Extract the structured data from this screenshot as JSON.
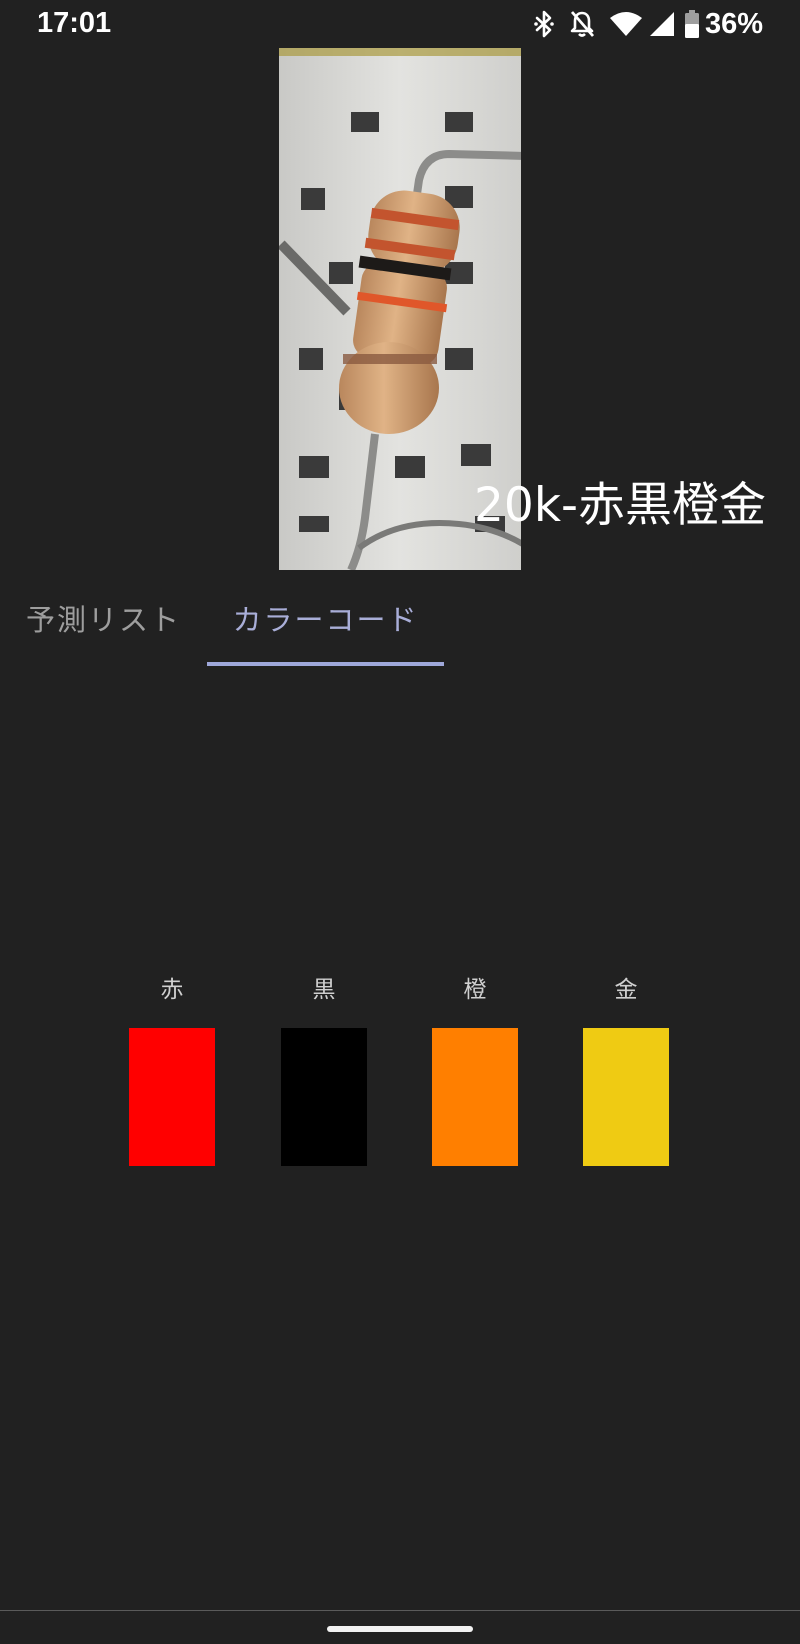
{
  "status_bar": {
    "time": "17:01",
    "battery_percent": "36%",
    "icons": [
      "bluetooth-icon",
      "notifications-off-icon",
      "wifi-icon",
      "cellular-signal-icon",
      "battery-icon"
    ]
  },
  "camera": {
    "prediction_label": "20k-赤黒橙金"
  },
  "tabs": [
    {
      "label": "予測リスト",
      "selected": false
    },
    {
      "label": "カラーコード",
      "selected": true
    }
  ],
  "bands": [
    {
      "label": "赤",
      "color": "#ff0000"
    },
    {
      "label": "黒",
      "color": "#000000"
    },
    {
      "label": "橙",
      "color": "#ff7f00"
    },
    {
      "label": "金",
      "color": "#efcb13"
    }
  ]
}
